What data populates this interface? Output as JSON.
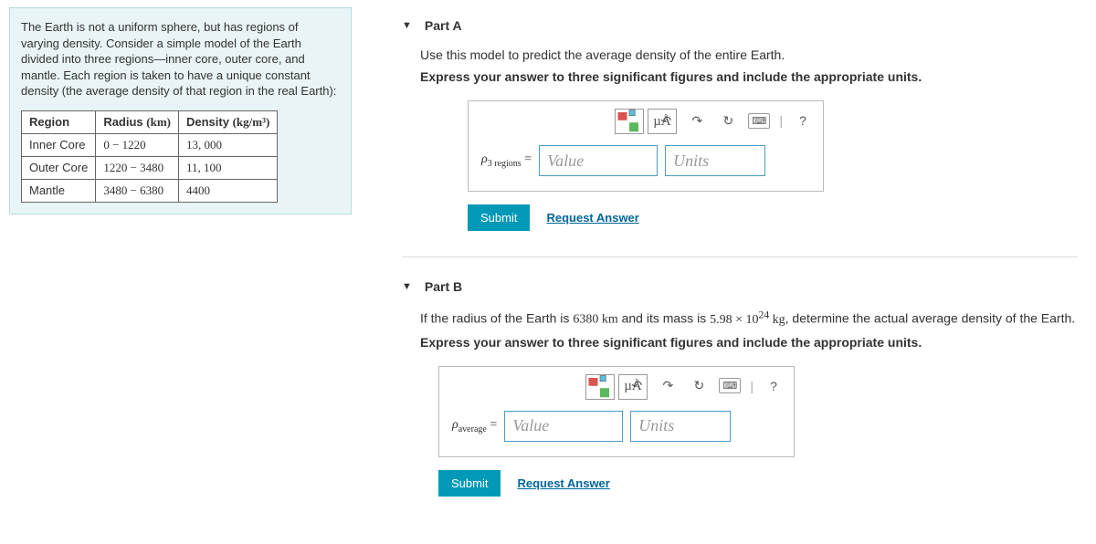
{
  "problem": {
    "intro": "The Earth is not a uniform sphere, but has regions of varying density. Consider a simple model of the Earth divided into three regions—inner core, outer core, and mantle. Each region is taken to have a unique constant density (the average density of that region in the real Earth):",
    "table": {
      "headers": {
        "region": "Region",
        "radius": "Radius",
        "radius_unit": "(km)",
        "density": "Density",
        "density_unit": "(kg/m³)"
      },
      "rows": [
        {
          "region": "Inner Core",
          "radius": "0 − 1220",
          "density": "13, 000"
        },
        {
          "region": "Outer Core",
          "radius": "1220 − 3480",
          "density": "11, 100"
        },
        {
          "region": "Mantle",
          "radius": "3480 − 6380",
          "density": "4400"
        }
      ]
    }
  },
  "partA": {
    "title": "Part A",
    "instruction": "Use this model to predict the average density of the entire Earth.",
    "instruction_bold": "Express your answer to three significant figures and include the appropriate units.",
    "label_var": "ρ",
    "label_sub": "3 regions",
    "label_eq": " = ",
    "value_placeholder": "Value",
    "units_placeholder": "Units",
    "submit": "Submit",
    "request": "Request Answer",
    "tool_units": "µÅ",
    "tool_help": "?"
  },
  "partB": {
    "title": "Part B",
    "instruction_pre": "If the radius of the Earth is ",
    "radius_val": "6380 km",
    "instruction_mid": " and its mass is ",
    "mass_val": "5.98 × 10",
    "mass_exp": "24",
    "mass_unit": " kg",
    "instruction_post": ", determine the actual average density of the Earth.",
    "instruction_bold": "Express your answer to three significant figures and include the appropriate units.",
    "label_var": "ρ",
    "label_sub": "average",
    "label_eq": " = ",
    "value_placeholder": "Value",
    "units_placeholder": "Units",
    "submit": "Submit",
    "request": "Request Answer",
    "tool_units": "µÅ",
    "tool_help": "?"
  }
}
